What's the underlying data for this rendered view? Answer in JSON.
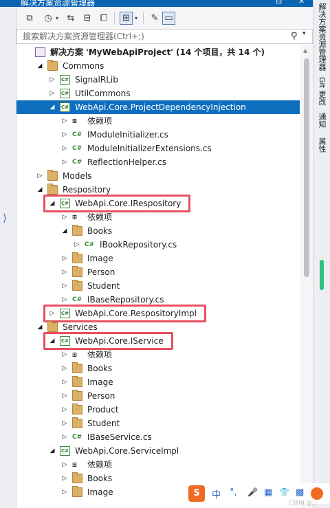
{
  "window": {
    "title": "解决方案资源管理器",
    "pin_glyph": "⊟",
    "close_glyph": "✕"
  },
  "search": {
    "placeholder": "搜索解决方案资源管理器(Ctrl+;)"
  },
  "tree": [
    {
      "label": "解决方案 'MyWebApiProject' (14 个项目，共 14 个)",
      "icon": "solution",
      "bold": true
    },
    {
      "label": "Commons",
      "icon": "folder",
      "expander": "expanded"
    },
    {
      "label": "SignalRLib",
      "icon": "csproj",
      "expander": "collapsed"
    },
    {
      "label": "UtilCommons",
      "icon": "csproj",
      "expander": "collapsed"
    },
    {
      "label": "WebApi.Core.ProjectDependencyInjection",
      "icon": "csproj",
      "expander": "expanded",
      "selected": true
    },
    {
      "label": "依赖项",
      "icon": "dependencies",
      "expander": "collapsed"
    },
    {
      "label": "IModuleInitializer.cs",
      "icon": "csfile",
      "expander": "collapsed"
    },
    {
      "label": "ModuleInitializerExtensions.cs",
      "icon": "csfile",
      "expander": "collapsed"
    },
    {
      "label": "ReflectionHelper.cs",
      "icon": "csfile",
      "expander": "collapsed"
    },
    {
      "label": "Models",
      "icon": "folder",
      "expander": "collapsed"
    },
    {
      "label": "Respository",
      "icon": "folder",
      "expander": "expanded"
    },
    {
      "label": "WebApi.Core.IRespository",
      "icon": "csproj",
      "expander": "expanded",
      "highlighted": true
    },
    {
      "label": "依赖项",
      "icon": "dependencies",
      "expander": "collapsed"
    },
    {
      "label": "Books",
      "icon": "folder",
      "expander": "expanded"
    },
    {
      "label": "IBookRepository.cs",
      "icon": "csfile",
      "expander": "collapsed"
    },
    {
      "label": "Image",
      "icon": "folder",
      "expander": "collapsed"
    },
    {
      "label": "Person",
      "icon": "folder",
      "expander": "collapsed"
    },
    {
      "label": "Student",
      "icon": "folder",
      "expander": "collapsed"
    },
    {
      "label": "IBaseRepository.cs",
      "icon": "csfile",
      "expander": "collapsed"
    },
    {
      "label": "WebApi.Core.RespositoryImpl",
      "icon": "csproj",
      "expander": "collapsed",
      "highlighted": true
    },
    {
      "label": "Services",
      "icon": "folder",
      "expander": "expanded"
    },
    {
      "label": "WebApi.Core.IService",
      "icon": "csproj",
      "expander": "expanded",
      "highlighted": true
    },
    {
      "label": "依赖项",
      "icon": "dependencies",
      "expander": "collapsed"
    },
    {
      "label": "Books",
      "icon": "folder",
      "expander": "collapsed"
    },
    {
      "label": "Image",
      "icon": "folder",
      "expander": "collapsed"
    },
    {
      "label": "Person",
      "icon": "folder",
      "expander": "collapsed"
    },
    {
      "label": "Product",
      "icon": "folder",
      "expander": "collapsed"
    },
    {
      "label": "Student",
      "icon": "folder",
      "expander": "collapsed"
    },
    {
      "label": "IBaseService.cs",
      "icon": "csfile",
      "expander": "collapsed"
    },
    {
      "label": "WebApi.Core.ServiceImpl",
      "icon": "csproj",
      "expander": "expanded"
    },
    {
      "label": "依赖项",
      "icon": "dependencies",
      "expander": "collapsed"
    },
    {
      "label": "Books",
      "icon": "folder",
      "expander": "collapsed"
    },
    {
      "label": "Image",
      "icon": "folder",
      "expander": "collapsed"
    }
  ],
  "right_tabs": [
    {
      "label": "解决方案资源管理器"
    },
    {
      "label": "Git 更改"
    },
    {
      "label": "通知"
    },
    {
      "label": "属性"
    }
  ],
  "ime_bar": {
    "chinese_mode": "中",
    "punct": "°,",
    "mic": "🎤",
    "keyboard": "▦",
    "skin": "👕",
    "grid": "▩"
  },
  "watermark": "CSDN @...",
  "colors": {
    "selection": "#0e6fbf",
    "highlight_box": "#e84f62",
    "titlebar": "#0a64b4"
  }
}
